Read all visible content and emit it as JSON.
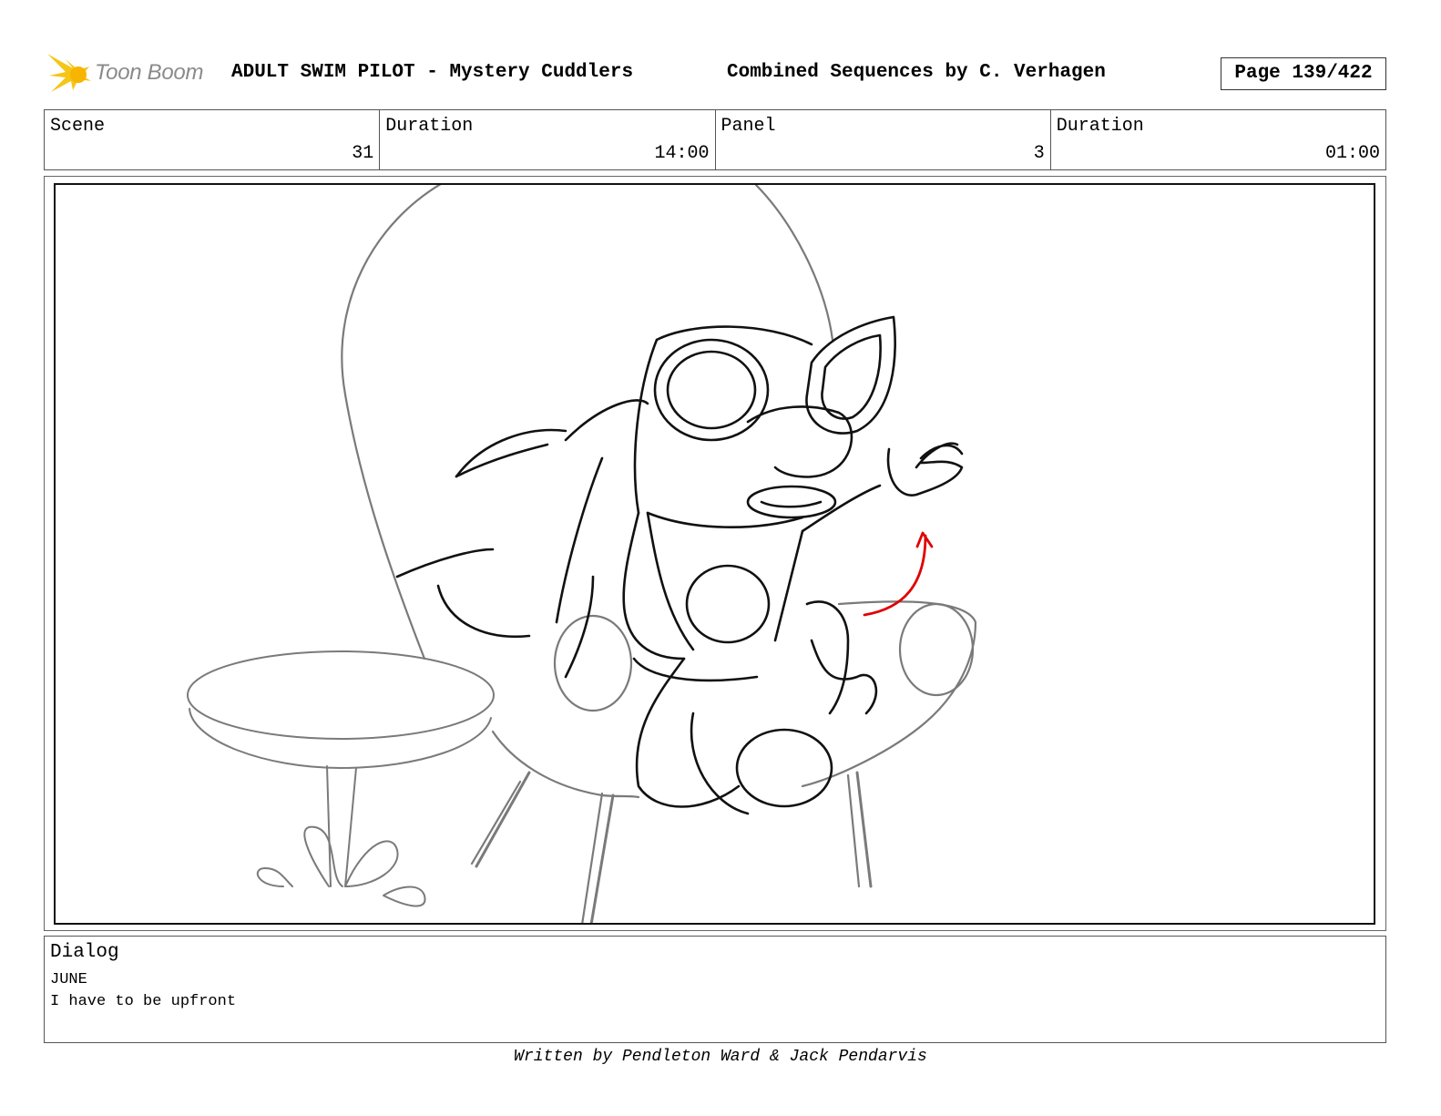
{
  "header": {
    "logo_text": "Toon Boom",
    "title": "ADULT SWIM PILOT - Mystery Cuddlers",
    "sequence": "Combined Sequences by C. Verhagen",
    "page": "Page 139/422"
  },
  "info": [
    {
      "label": "Scene",
      "value": "31"
    },
    {
      "label": "Duration",
      "value": "14:00"
    },
    {
      "label": "Panel",
      "value": "3"
    },
    {
      "label": "Duration",
      "value": "01:00"
    }
  ],
  "dialog": {
    "label": "Dialog",
    "speaker": "JUNE",
    "line": "I have to be upfront"
  },
  "footer": {
    "credit": "Written by Pendleton Ward & Jack Pendarvis"
  },
  "colors": {
    "logo_yellow": "#f5c518",
    "action_arrow": "#e00000"
  }
}
